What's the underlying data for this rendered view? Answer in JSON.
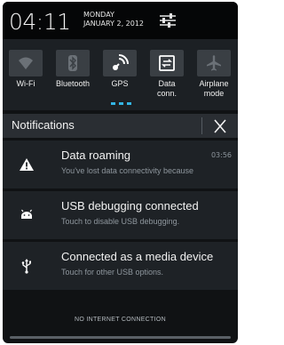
{
  "header": {
    "time": "04:11",
    "day": "MONDAY",
    "date": "JANUARY 2, 2012",
    "settings_icon": "settings-sliders-icon"
  },
  "toggles": [
    {
      "label": "Wi-Fi",
      "icon": "wifi-icon",
      "active": false
    },
    {
      "label": "Bluetooth",
      "icon": "bluetooth-icon",
      "active": false
    },
    {
      "label": "GPS",
      "icon": "gps-icon",
      "active": true
    },
    {
      "label": "Data\nconn.",
      "icon": "data-connection-icon",
      "active": true
    },
    {
      "label": "Airplane\nmode",
      "icon": "airplane-icon",
      "active": false
    }
  ],
  "toggles_labels": {
    "wifi": "Wi-Fi",
    "bluetooth": "Bluetooth",
    "gps": "GPS",
    "data_line1": "Data",
    "data_line2": "conn.",
    "airplane_line1": "Airplane",
    "airplane_line2": "mode"
  },
  "notifications_header": {
    "title": "Notifications",
    "close_icon": "close-icon"
  },
  "notifications": [
    {
      "title": "Data roaming",
      "subtitle": "You've lost data connectivity because",
      "time": "03:56",
      "icon": "warning-icon"
    },
    {
      "title": "USB debugging connected",
      "subtitle": "Touch to disable USB debugging.",
      "time": "",
      "icon": "android-icon"
    },
    {
      "title": "Connected as a media device",
      "subtitle": "Touch for other USB options.",
      "time": "",
      "icon": "usb-icon"
    }
  ],
  "footer": {
    "status": "NO INTERNET CONNECTION"
  },
  "colors": {
    "accent": "#33b5e5",
    "background": "#101214",
    "tile": "#3a3f44"
  }
}
